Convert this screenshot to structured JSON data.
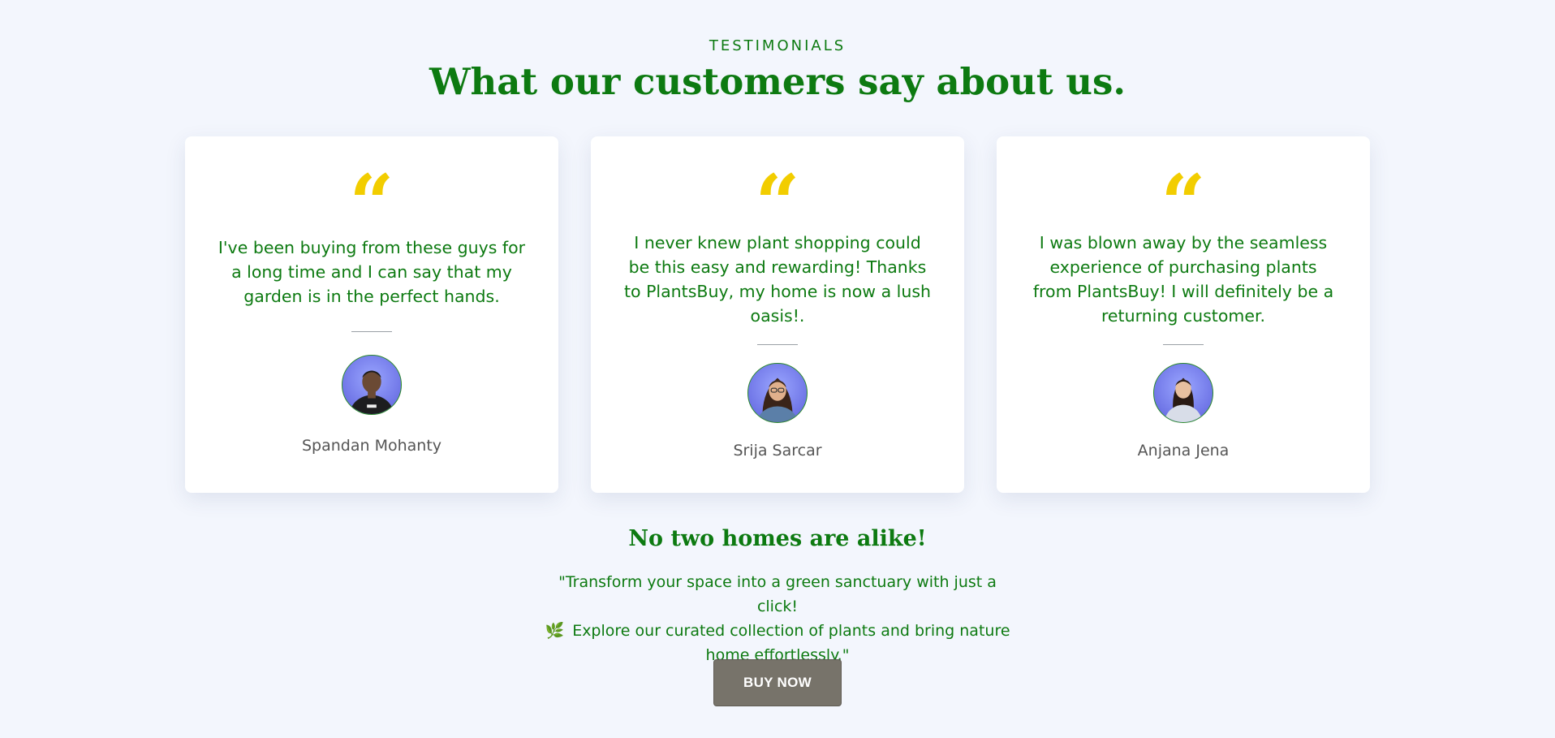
{
  "header": {
    "eyebrow": "TESTIMONIALS",
    "title": "What our customers say about us."
  },
  "testimonials": [
    {
      "quote": "I've been buying from these guys for a long time and I can say that my garden is in the perfect hands.",
      "name": "Spandan Mohanty"
    },
    {
      "quote": "I never knew plant shopping could be this easy and rewarding! Thanks to PlantsBuy, my home is now a lush oasis!.",
      "name": "Srija Sarcar"
    },
    {
      "quote": "I was blown away by the seamless experience of purchasing plants from PlantsBuy! I will definitely be a returning customer.",
      "name": "Anjana Jena"
    }
  ],
  "quote_glyph": "“",
  "cta": {
    "title": "No two homes are alike!",
    "text_line1": "\"Transform your space into a green sanctuary with just a click!",
    "leaf_icon": "🌿",
    "text_line2": "Explore our curated collection of plants and bring nature home effortlessly.\"",
    "button_label": "BUY NOW"
  },
  "colors": {
    "accent_green": "#0d7a11",
    "quote_yellow": "#f2cd00",
    "background": "#f3f6fd",
    "button": "#77736a"
  }
}
